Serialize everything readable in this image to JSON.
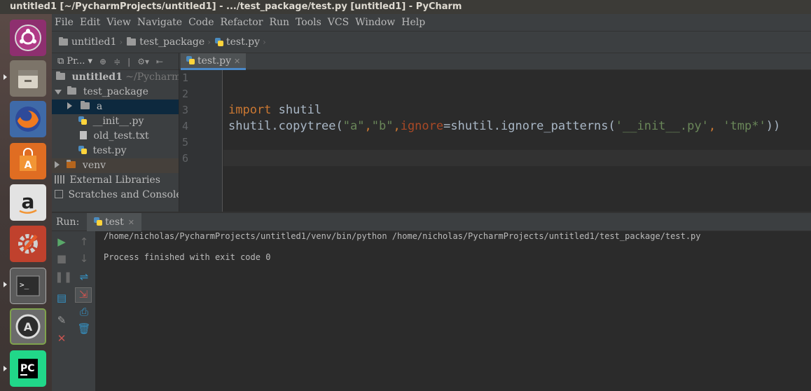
{
  "window": {
    "title": "untitled1 [~/PycharmProjects/untitled1] - .../test_package/test.py [untitled1] - PyCharm"
  },
  "launcher": {
    "items": [
      "ubuntu-dash",
      "files",
      "firefox",
      "software-center",
      "amazon",
      "system-settings",
      "terminal",
      "software-updater",
      "pycharm"
    ]
  },
  "menu": [
    "File",
    "Edit",
    "View",
    "Navigate",
    "Code",
    "Refactor",
    "Run",
    "Tools",
    "VCS",
    "Window",
    "Help"
  ],
  "breadcrumbs": [
    "untitled1",
    "test_package",
    "test.py"
  ],
  "project_panel": {
    "label": "Pr...",
    "root": {
      "name": "untitled1",
      "path": "~/Pycharm"
    },
    "tree": {
      "test_package": "test_package",
      "a": "a",
      "init": "__init__.py",
      "old_test": "old_test.txt",
      "test": "test.py",
      "venv": "venv",
      "external": "External Libraries",
      "scratches": "Scratches and Consoles"
    }
  },
  "editor": {
    "tab": "test.py",
    "line_numbers": [
      "1",
      "2",
      "3",
      "4",
      "5",
      "6"
    ],
    "code": {
      "l3_kw": "import",
      "l3_rest": " shutil",
      "l4_a": "shutil.copytree(",
      "l4_s1": "\"a\"",
      "l4_c1": ",",
      "l4_s2": "\"b\"",
      "l4_c2": ",",
      "l4_param": "ignore",
      "l4_b": "=shutil.ignore_patterns(",
      "l4_s3": "'__init__.py'",
      "l4_c3": ", ",
      "l4_s4": "'tmp*'",
      "l4_end": "))"
    }
  },
  "run": {
    "label": "Run:",
    "tab": "test",
    "console": [
      "/home/nicholas/PycharmProjects/untitled1/venv/bin/python /home/nicholas/PycharmProjects/untitled1/test_package/test.py",
      "Process finished with exit code 0"
    ]
  },
  "colors": {
    "keyword": "#cc7832",
    "string": "#6a8759",
    "parameter": "#aa4926",
    "selection": "#0d293e",
    "tab_underline": "#4a88c7"
  }
}
